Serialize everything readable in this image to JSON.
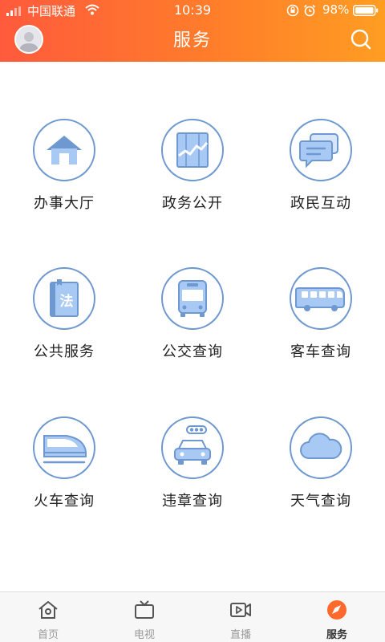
{
  "colors": {
    "header_start": "#ff5a3c",
    "header_end": "#ff9d22",
    "icon_outline": "#6d98d0",
    "icon_fill": "#a9c9f5",
    "active_tab": "#ff6a2c"
  },
  "status_bar": {
    "carrier": "中国联通",
    "time": "10:39",
    "battery": "98%"
  },
  "header": {
    "title": "服务"
  },
  "services": [
    {
      "label": "办事大厅",
      "icon": "house-icon"
    },
    {
      "label": "政务公开",
      "icon": "chart-panel-icon"
    },
    {
      "label": "政民互动",
      "icon": "chat-bubbles-icon"
    },
    {
      "label": "公共服务",
      "icon": "law-book-icon"
    },
    {
      "label": "公交查询",
      "icon": "city-bus-icon"
    },
    {
      "label": "客车查询",
      "icon": "coach-bus-icon"
    },
    {
      "label": "火车查询",
      "icon": "bullet-train-icon"
    },
    {
      "label": "违章查询",
      "icon": "traffic-car-icon"
    },
    {
      "label": "天气查询",
      "icon": "cloud-icon"
    }
  ],
  "tabs": [
    {
      "label": "首页",
      "icon": "home-icon",
      "active": false
    },
    {
      "label": "电视",
      "icon": "tv-icon",
      "active": false
    },
    {
      "label": "直播",
      "icon": "live-video-icon",
      "active": false
    },
    {
      "label": "服务",
      "icon": "compass-icon",
      "active": true
    }
  ]
}
